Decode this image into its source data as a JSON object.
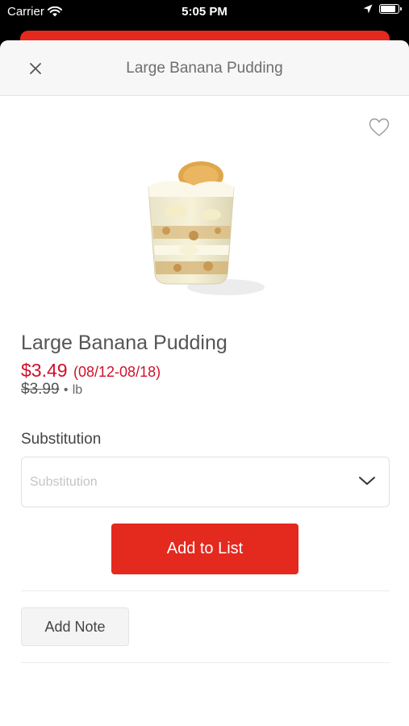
{
  "status_bar": {
    "carrier": "Carrier",
    "time": "5:05 PM",
    "battery_level": 0.9
  },
  "header": {
    "title": "Large Banana Pudding",
    "close_icon": "close-icon"
  },
  "product": {
    "name": "Large Banana Pudding",
    "price": "$3.49",
    "sale_dates": "(08/12-08/18)",
    "regular_price": "$3.99",
    "separator": "•",
    "unit": "lb",
    "favorite_icon": "heart-outline-icon",
    "image_icon": "banana-pudding-cup-image"
  },
  "substitution": {
    "label": "Substitution",
    "placeholder": "Substitution",
    "chevron_icon": "chevron-down-icon"
  },
  "actions": {
    "add_to_list": "Add to List",
    "add_note": "Add Note"
  },
  "colors": {
    "accent_red": "#e4291f",
    "price_red": "#d0102b",
    "header_bg": "#f7f7f7"
  }
}
